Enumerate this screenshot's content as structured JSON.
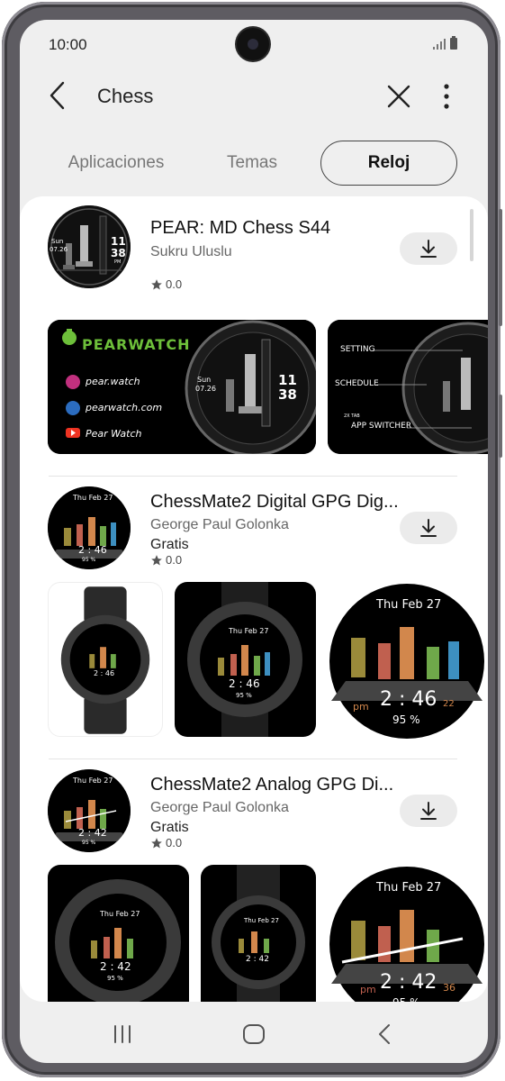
{
  "status_bar": {
    "time": "10:00"
  },
  "app_bar": {
    "search_query": "Chess"
  },
  "tabs": [
    {
      "label": "Aplicaciones",
      "selected": false
    },
    {
      "label": "Temas",
      "selected": false
    },
    {
      "label": "Reloj",
      "selected": true
    }
  ],
  "results": [
    {
      "name": "PEAR: MD Chess S44",
      "developer": "Sukru Uluslu",
      "price": "",
      "rating": "0.0",
      "face": {
        "day": "Sun",
        "date": "07.26",
        "hour": "11",
        "minute": "38",
        "ampm": "PM"
      },
      "banner": {
        "brand": "PEARWATCH",
        "links": [
          "pear.watch",
          "pearwatch.com",
          "Pear Watch"
        ]
      },
      "guide": {
        "labels": [
          "SETTING",
          "SCHEDULE",
          "APP SWITCHER"
        ],
        "small_label": "2X TAB"
      }
    },
    {
      "name": "ChessMate2 Digital GPG Dig...",
      "developer": "George Paul Golonka",
      "price": "Gratis",
      "rating": "0.0",
      "face": {
        "date": "Thu Feb 27",
        "time": "2 : 46",
        "battery": "95 %",
        "ampm": "pm",
        "left_value": "",
        "right_value": "22"
      }
    },
    {
      "name": "ChessMate2 Analog GPG Di...",
      "developer": "George Paul Golonka",
      "price": "Gratis",
      "rating": "0.0",
      "face": {
        "date": "Thu Feb 27",
        "time": "2 : 42",
        "battery": "95 %",
        "ampm": "pm",
        "right_value": "36"
      }
    }
  ],
  "colors": {
    "accent_green": "#6dbf3a",
    "background": "#efefef",
    "card": "#ffffff"
  },
  "icons": [
    "back-arrow-icon",
    "close-icon",
    "more-vertical-icon",
    "download-icon",
    "star-icon",
    "recent-apps-icon",
    "home-icon",
    "back-nav-icon"
  ]
}
